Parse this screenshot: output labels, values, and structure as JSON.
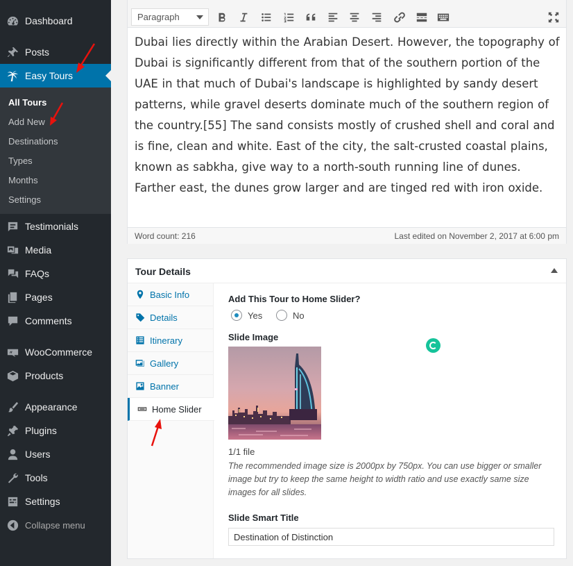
{
  "sidebar": {
    "items": [
      {
        "label": "Dashboard",
        "icon": "dashboard-icon"
      },
      {
        "label": "Posts",
        "icon": "pin-icon"
      },
      {
        "label": "Easy Tours",
        "icon": "palm-tree-icon"
      },
      {
        "label": "Testimonials",
        "icon": "testimonial-icon"
      },
      {
        "label": "Media",
        "icon": "media-icon"
      },
      {
        "label": "FAQs",
        "icon": "faq-icon"
      },
      {
        "label": "Pages",
        "icon": "pages-icon"
      },
      {
        "label": "Comments",
        "icon": "comments-icon"
      },
      {
        "label": "WooCommerce",
        "icon": "woocommerce-icon"
      },
      {
        "label": "Products",
        "icon": "products-icon"
      },
      {
        "label": "Appearance",
        "icon": "brush-icon"
      },
      {
        "label": "Plugins",
        "icon": "plugins-icon"
      },
      {
        "label": "Users",
        "icon": "users-icon"
      },
      {
        "label": "Tools",
        "icon": "wrench-icon"
      },
      {
        "label": "Settings",
        "icon": "settings-icon"
      },
      {
        "label": "Collapse menu",
        "icon": "collapse-icon"
      }
    ],
    "submenu": [
      "All Tours",
      "Add New",
      "Destinations",
      "Types",
      "Months",
      "Settings"
    ]
  },
  "editor": {
    "format": "Paragraph",
    "content": "Dubai lies directly within the Arabian Desert. However, the topography of Dubai is significantly different from that of the southern portion of the UAE in that much of Dubai's landscape is highlighted by sandy desert patterns, while gravel deserts dominate much of the southern region of the country.[55] The sand consists mostly of crushed shell and coral and is fine, clean and white. East of the city, the salt-crusted coastal plains, known as sabkha, give way to a north-south running line of dunes. Farther east, the dunes grow larger and are tinged red with iron oxide.",
    "word_count": "Word count: 216",
    "last_edited": "Last edited on November 2, 2017 at 6:00 pm"
  },
  "tour_details": {
    "title": "Tour Details",
    "tabs": [
      "Basic Info",
      "Details",
      "Itinerary",
      "Gallery",
      "Banner",
      "Home Slider"
    ],
    "slider_question": "Add This Tour to Home Slider?",
    "yes_label": "Yes",
    "no_label": "No",
    "slide_image_label": "Slide Image",
    "file_count": "1/1 file",
    "description": "The recommended image size is 2000px by 750px. You can use bigger or smaller image but try to keep the same height to width ratio and use exactly same size images for all slides.",
    "smart_title_label": "Slide Smart Title",
    "smart_title_value": "Destination of Distinction"
  }
}
